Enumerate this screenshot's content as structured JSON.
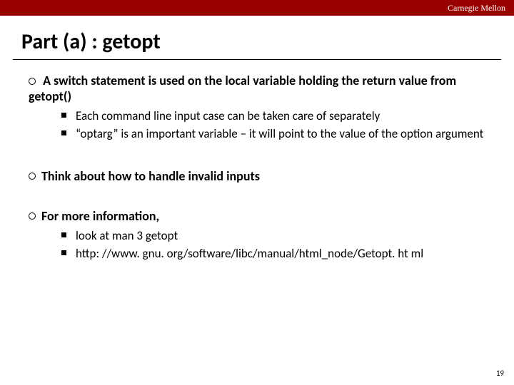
{
  "header": {
    "brand": "Carnegie Mellon"
  },
  "title": "Part (a) : getopt",
  "bullets": {
    "b1": {
      "text": "A switch statement is used on the local variable holding the return value from getopt()",
      "subs": [
        "Each command line input case can be taken care of separately",
        "“optarg” is an important variable – it will point to the value of the option argument"
      ]
    },
    "b2": {
      "text": "Think about how to handle invalid inputs"
    },
    "b3": {
      "text": "For more information,",
      "subs": [
        "look at man 3 getopt",
        "http: //www. gnu. org/software/libc/manual/html_node/Getopt. ht ml"
      ]
    }
  },
  "page_number": "19"
}
